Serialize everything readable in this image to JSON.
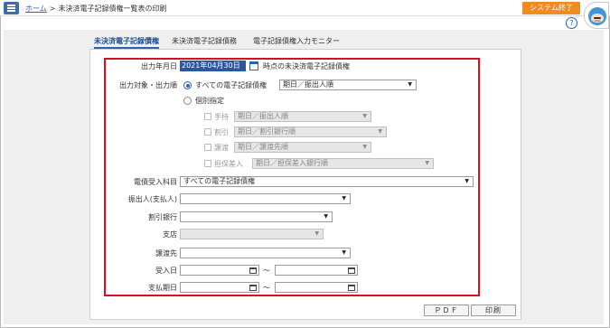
{
  "header": {
    "breadcrumb_home": "ホーム",
    "breadcrumb_sep": ">",
    "page_title": "未決済電子記録債権一覧表の印刷",
    "exit_label": "システム終了",
    "help_label": "?"
  },
  "tabs": [
    {
      "label": "未決済電子記録債権",
      "active": true
    },
    {
      "label": "未決済電子記録債務",
      "active": false
    },
    {
      "label": "電子記録債権入力モニター",
      "active": false
    }
  ],
  "form": {
    "output_date_label": "出力年月日",
    "output_date_value": "2021年04月30日",
    "output_date_suffix": "時点の未決済電子記録債権",
    "target_label": "出力対象・出力順",
    "all_radio_label": "すべての電子記録債権",
    "all_order_value": "期日／振出人順",
    "individual_radio_label": "個別指定",
    "individual_items": [
      {
        "label": "手持",
        "order": "期日／振出人順"
      },
      {
        "label": "割引",
        "order": "期日／割引銀行順"
      },
      {
        "label": "譲渡",
        "order": "期日／譲渡先順"
      },
      {
        "label": "担保差入",
        "order": "期日／担保差入銀行順"
      }
    ],
    "account_label": "電債受入科目",
    "account_value": "すべての電子記録債権",
    "drawer_label": "振出人(支払人)",
    "drawer_value": "",
    "bank_label": "割引銀行",
    "bank_value": "",
    "branch_label": "支店",
    "branch_value": "",
    "transferee_label": "譲渡先",
    "transferee_value": "",
    "received_date_label": "受入日",
    "due_date_label": "支払期日",
    "range_sep": "〜"
  },
  "footer": {
    "pdf_label": "ＰＤＦ",
    "print_label": "印刷"
  },
  "colors": {
    "accent": "#2a62b0",
    "exit": "#f08a24",
    "highlight_border": "#d40f1f"
  }
}
